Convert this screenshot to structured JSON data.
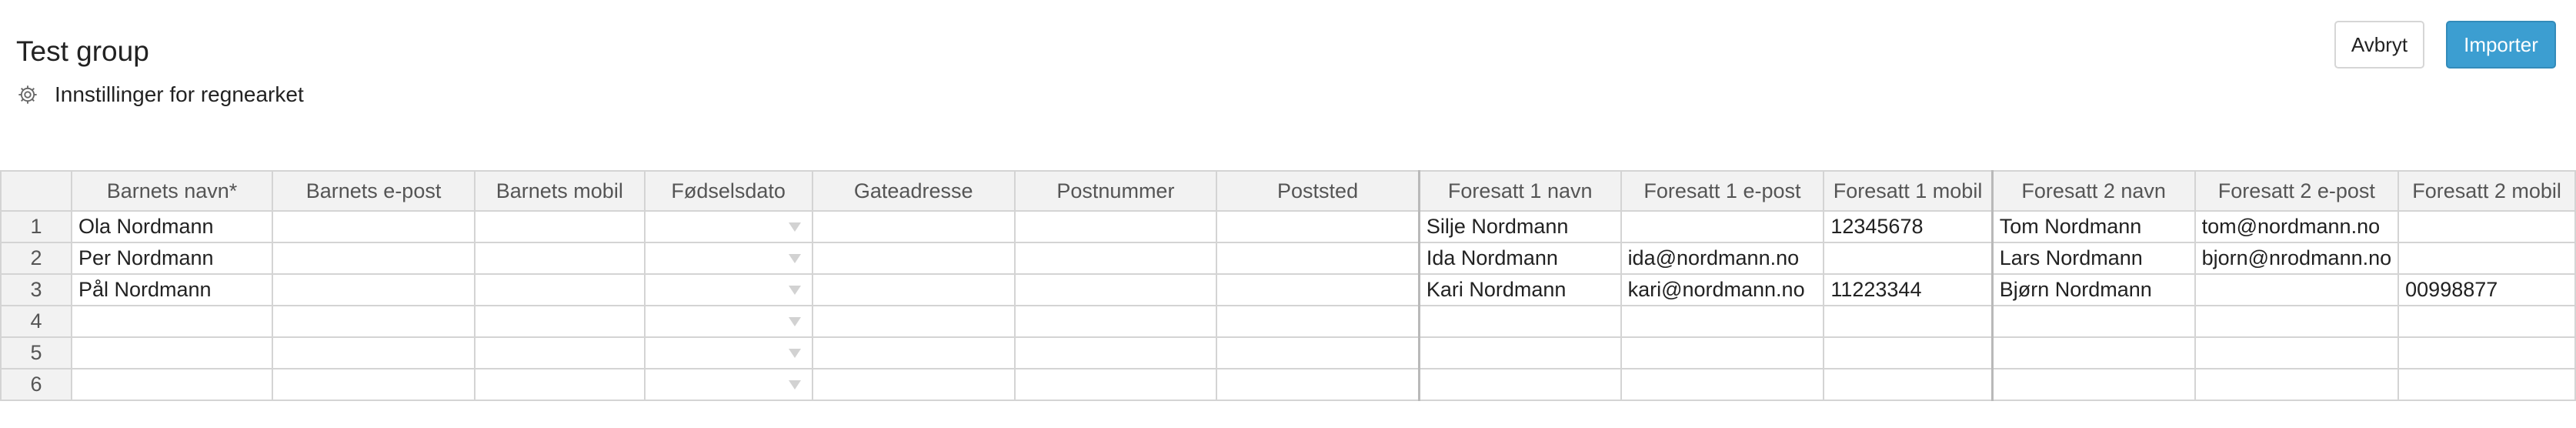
{
  "header": {
    "title": "Test group",
    "settings_label": "Innstillinger for regnearket",
    "settings_icon": "gear-icon"
  },
  "actions": {
    "cancel_label": "Avbryt",
    "import_label": "Importer",
    "import_color": "#3c9ed1"
  },
  "sheet": {
    "columns": [
      "Barnets navn*",
      "Barnets e-post",
      "Barnets mobil",
      "Fødselsdato",
      "Gateadresse",
      "Postnummer",
      "Poststed",
      "Foresatt 1 navn",
      "Foresatt 1 e-post",
      "Foresatt 1 mobil",
      "Foresatt 2 navn",
      "Foresatt 2 e-post",
      "Foresatt 2 mobil"
    ],
    "rows": [
      {
        "num": "1",
        "cells": [
          "Ola Nordmann",
          "",
          "",
          "",
          "",
          "",
          "",
          "Silje Nordmann",
          "",
          "12345678",
          "Tom Nordmann",
          "tom@nordmann.no",
          ""
        ]
      },
      {
        "num": "2",
        "cells": [
          "Per Nordmann",
          "",
          "",
          "",
          "",
          "",
          "",
          "Ida Nordmann",
          "ida@nordmann.no",
          "",
          "Lars Nordmann",
          "bjorn@nrodmann.no",
          ""
        ]
      },
      {
        "num": "3",
        "cells": [
          "Pål Nordmann",
          "",
          "",
          "",
          "",
          "",
          "",
          "Kari Nordmann",
          "kari@nordmann.no",
          "11223344",
          "Bjørn Nordmann",
          "",
          "00998877"
        ]
      },
      {
        "num": "4",
        "cells": [
          "",
          "",
          "",
          "",
          "",
          "",
          "",
          "",
          "",
          "",
          "",
          "",
          ""
        ]
      },
      {
        "num": "5",
        "cells": [
          "",
          "",
          "",
          "",
          "",
          "",
          "",
          "",
          "",
          "",
          "",
          "",
          ""
        ]
      },
      {
        "num": "6",
        "cells": [
          "",
          "",
          "",
          "",
          "",
          "",
          "",
          "",
          "",
          "",
          "",
          "",
          ""
        ]
      }
    ]
  }
}
